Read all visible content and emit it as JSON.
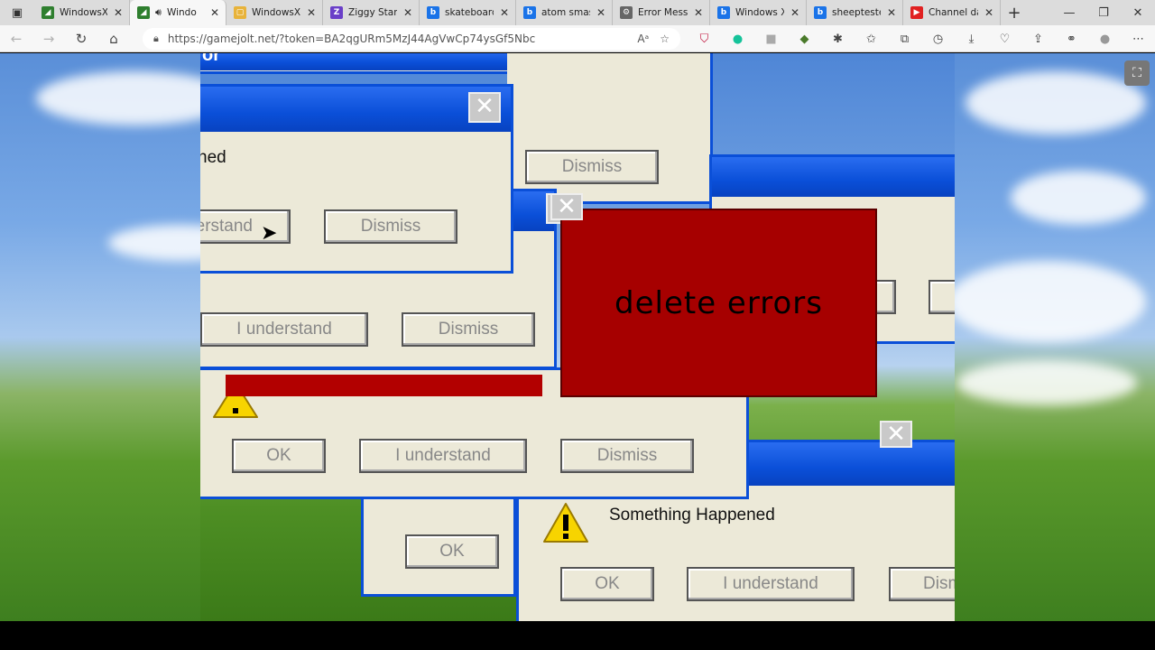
{
  "browser": {
    "tabs": [
      {
        "title": "WindowsXP",
        "favicon": "gamejolt-icon",
        "active": false
      },
      {
        "title": "Windo",
        "favicon": "gamejolt-icon",
        "active": true,
        "audio": true
      },
      {
        "title": "WindowsXP",
        "favicon": "page-icon",
        "active": false
      },
      {
        "title": "Ziggy Stard",
        "favicon": "ziggy-icon",
        "active": false
      },
      {
        "title": "skateboard",
        "favicon": "bing-icon",
        "active": false
      },
      {
        "title": "atom smash",
        "favicon": "bing-icon",
        "active": false
      },
      {
        "title": "Error Messa",
        "favicon": "error-icon",
        "active": false
      },
      {
        "title": "Windows X",
        "favicon": "bing-icon",
        "active": false
      },
      {
        "title": "sheepteste",
        "favicon": "bing-icon",
        "active": false
      },
      {
        "title": "Channel da",
        "favicon": "youtube-icon",
        "active": false
      }
    ],
    "url": "https://gamejolt.net/?token=BA2qgURm5MzJ44AgVwCp74ysGf5Nbc"
  },
  "game": {
    "delete_errors_label": "delete errors",
    "dialogs": {
      "top_title_fragment": "or",
      "w1_message_fragment": "ned",
      "w1_understand": "erstand",
      "w1_dismiss": "Dismiss",
      "w2_dismiss": "Dismiss",
      "w3_understand": "I understand",
      "w3_dismiss": "Dismiss",
      "w5_ok": "OK",
      "w5_understand": "I understand",
      "w5_dismiss": "Dismiss",
      "w6_ok": "OK",
      "w7_message": "Something Happened",
      "w7_ok": "OK",
      "w7_understand": "I understand",
      "w7_dismiss": "Dism"
    }
  },
  "colors": {
    "xp_blue": "#0a4fd8",
    "dialog_bg": "#ece9d8",
    "delete_red": "#a60000"
  }
}
